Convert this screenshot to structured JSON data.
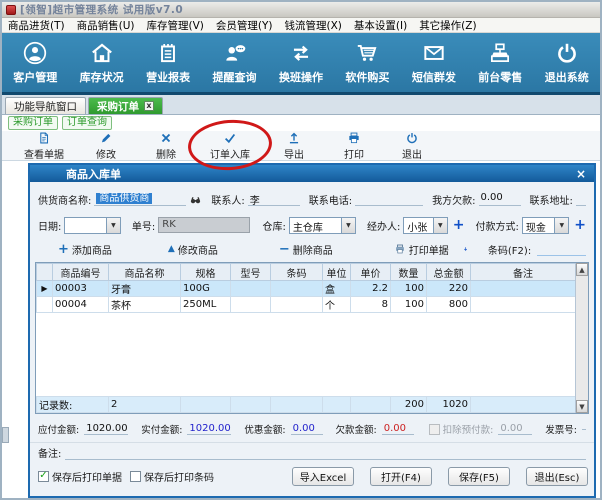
{
  "window": {
    "title": "[领智]超市管理系统 试用版v7.0"
  },
  "menu": {
    "items": [
      "商品进货(T)",
      "商品销售(U)",
      "库存管理(V)",
      "会员管理(Y)",
      "钱流管理(X)",
      "基本设置(I)",
      "其它操作(Z)"
    ]
  },
  "main_toolbar": {
    "items": [
      {
        "label": "客户管理",
        "icon": "customer-icon"
      },
      {
        "label": "库存状况",
        "icon": "warehouse-icon"
      },
      {
        "label": "营业报表",
        "icon": "report-icon"
      },
      {
        "label": "提醒查询",
        "icon": "reminder-icon"
      },
      {
        "label": "换班操作",
        "icon": "shift-change-icon"
      },
      {
        "label": "软件购买",
        "icon": "cart-icon"
      },
      {
        "label": "短信群发",
        "icon": "sms-icon"
      },
      {
        "label": "前台零售",
        "icon": "cash-register-icon"
      },
      {
        "label": "退出系统",
        "icon": "power-icon"
      }
    ]
  },
  "tabs": {
    "nav": "功能导航窗口",
    "active": "采购订单"
  },
  "subtabs": {
    "items": [
      "采购订单",
      "订单查询"
    ]
  },
  "order_toolbar": {
    "items": [
      {
        "label": "查看单据",
        "icon": "view-document-icon"
      },
      {
        "label": "修改",
        "icon": "edit-pencil-icon"
      },
      {
        "label": "删除",
        "icon": "delete-x-icon"
      },
      {
        "label": "订单入库",
        "icon": "stock-in-check-icon"
      },
      {
        "label": "导出",
        "icon": "export-icon"
      },
      {
        "label": "打印",
        "icon": "print-icon"
      },
      {
        "label": "退出",
        "icon": "exit-power-icon"
      }
    ]
  },
  "panel": {
    "title": "商品入库单",
    "close_glyph": "×",
    "supplier": {
      "name_label": "供货商名称:",
      "name_value": "商品供货商",
      "contact_label": "联系人:",
      "contact_value": "李",
      "phone_label": "联系电话:",
      "phone_value": "",
      "our_debt_label": "我方欠款:",
      "our_debt_value": "0.00",
      "address_label": "联系地址:",
      "address_value": ""
    },
    "info": {
      "date_label": "日期:",
      "date_value": "",
      "order_no_label": "单号:",
      "order_no_value": "RK",
      "warehouse_label": "仓库:",
      "warehouse_value": "主仓库",
      "handler_label": "经办人:",
      "handler_value": "小张",
      "payment_label": "付款方式:",
      "payment_value": "现金"
    },
    "actions": {
      "add_label": "添加商品",
      "edit_label": "修改商品",
      "delete_label": "删除商品",
      "print_label": "打印单据",
      "barcode_label": "条码(F2):",
      "barcode_value": ""
    },
    "grid": {
      "columns": [
        "商品编号",
        "商品名称",
        "规格",
        "型号",
        "条码",
        "单位",
        "单价",
        "数量",
        "总金额",
        "备注"
      ],
      "selected_marker": "▶",
      "rows": [
        {
          "code": "00003",
          "name": "牙膏",
          "spec": "100G",
          "model": "",
          "barcode": "",
          "unit": "盒",
          "price": "2.2",
          "qty": "100",
          "total": "220",
          "remark": ""
        },
        {
          "code": "00004",
          "name": "茶杯",
          "spec": "250ML",
          "model": "",
          "barcode": "",
          "unit": "个",
          "price": "8",
          "qty": "100",
          "total": "800",
          "remark": ""
        }
      ],
      "footer": {
        "label": "记录数:",
        "count": "2",
        "qty_total": "200",
        "amount_total": "1020"
      }
    },
    "amounts": {
      "payable_label": "应付金额:",
      "payable_value": "1020.00",
      "paid_label": "实付金额:",
      "paid_value": "1020.00",
      "discount_label": "优惠金额:",
      "discount_value": "0.00",
      "debt_label": "欠款金额:",
      "debt_value": "0.00",
      "deduct_label": "扣除预付款:",
      "deduct_value": "0.00",
      "invoice_label": "发票号:",
      "invoice_value": ""
    },
    "remark": {
      "label": "备注:",
      "value": ""
    },
    "options": [
      {
        "label": "保存后打印单据",
        "checked": true
      },
      {
        "label": "保存后打印条码",
        "checked": false
      }
    ],
    "buttons": [
      {
        "label": "导入Excel"
      },
      {
        "label": "打开(F4)"
      },
      {
        "label": "保存(F5)"
      },
      {
        "label": "退出(Esc)"
      }
    ]
  },
  "colors": {
    "toolbar_blue": "#2e7dab",
    "tab_green": "#3caa3c",
    "panel_header_blue": "#1d6ab0",
    "selection_blue": "#2f80d0",
    "value_blue": "#2222cc",
    "value_red": "#cc2222",
    "annotation_red": "#d01818"
  }
}
